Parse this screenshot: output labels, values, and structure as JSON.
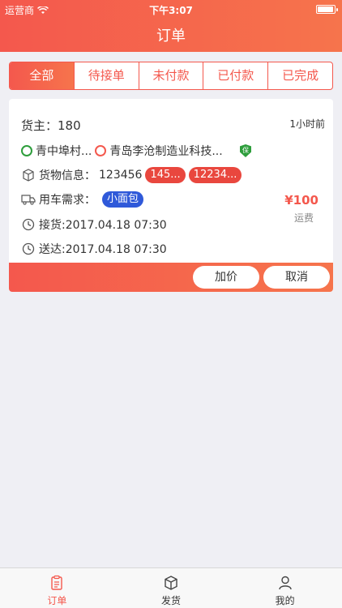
{
  "status_bar": {
    "carrier": "运营商",
    "time": "下午3:07"
  },
  "nav": {
    "title": "订单"
  },
  "tabs": [
    {
      "label": "全部",
      "active": true
    },
    {
      "label": "待接单",
      "active": false
    },
    {
      "label": "未付款",
      "active": false
    },
    {
      "label": "已付款",
      "active": false
    },
    {
      "label": "已完成",
      "active": false
    }
  ],
  "order": {
    "owner": "货主：180",
    "time_ago": "1小时前",
    "from": "青中埠村...",
    "to": "青岛李沧制造业科技...",
    "insurance_badge": "保",
    "cargo_label": "货物信息：",
    "cargo_value": "123456",
    "cargo_tags": [
      "145...",
      "12234..."
    ],
    "vehicle_label": "用车需求：",
    "vehicle_type": "小面包",
    "price": "¥100",
    "price_label": "运费",
    "pickup": "接货:2017.04.18 07:30",
    "delivery": "送达:2017.04.18 07:30",
    "add_price_button": "加价",
    "cancel_button": "取消"
  },
  "tabbar": [
    {
      "label": "订单",
      "icon": "clipboard-icon",
      "active": true
    },
    {
      "label": "发货",
      "icon": "box-icon",
      "active": false
    },
    {
      "label": "我的",
      "icon": "person-icon",
      "active": false
    }
  ],
  "colors": {
    "accent": "#f4584d",
    "blue_tag": "#2f59d9",
    "green": "#2e9e3c"
  }
}
